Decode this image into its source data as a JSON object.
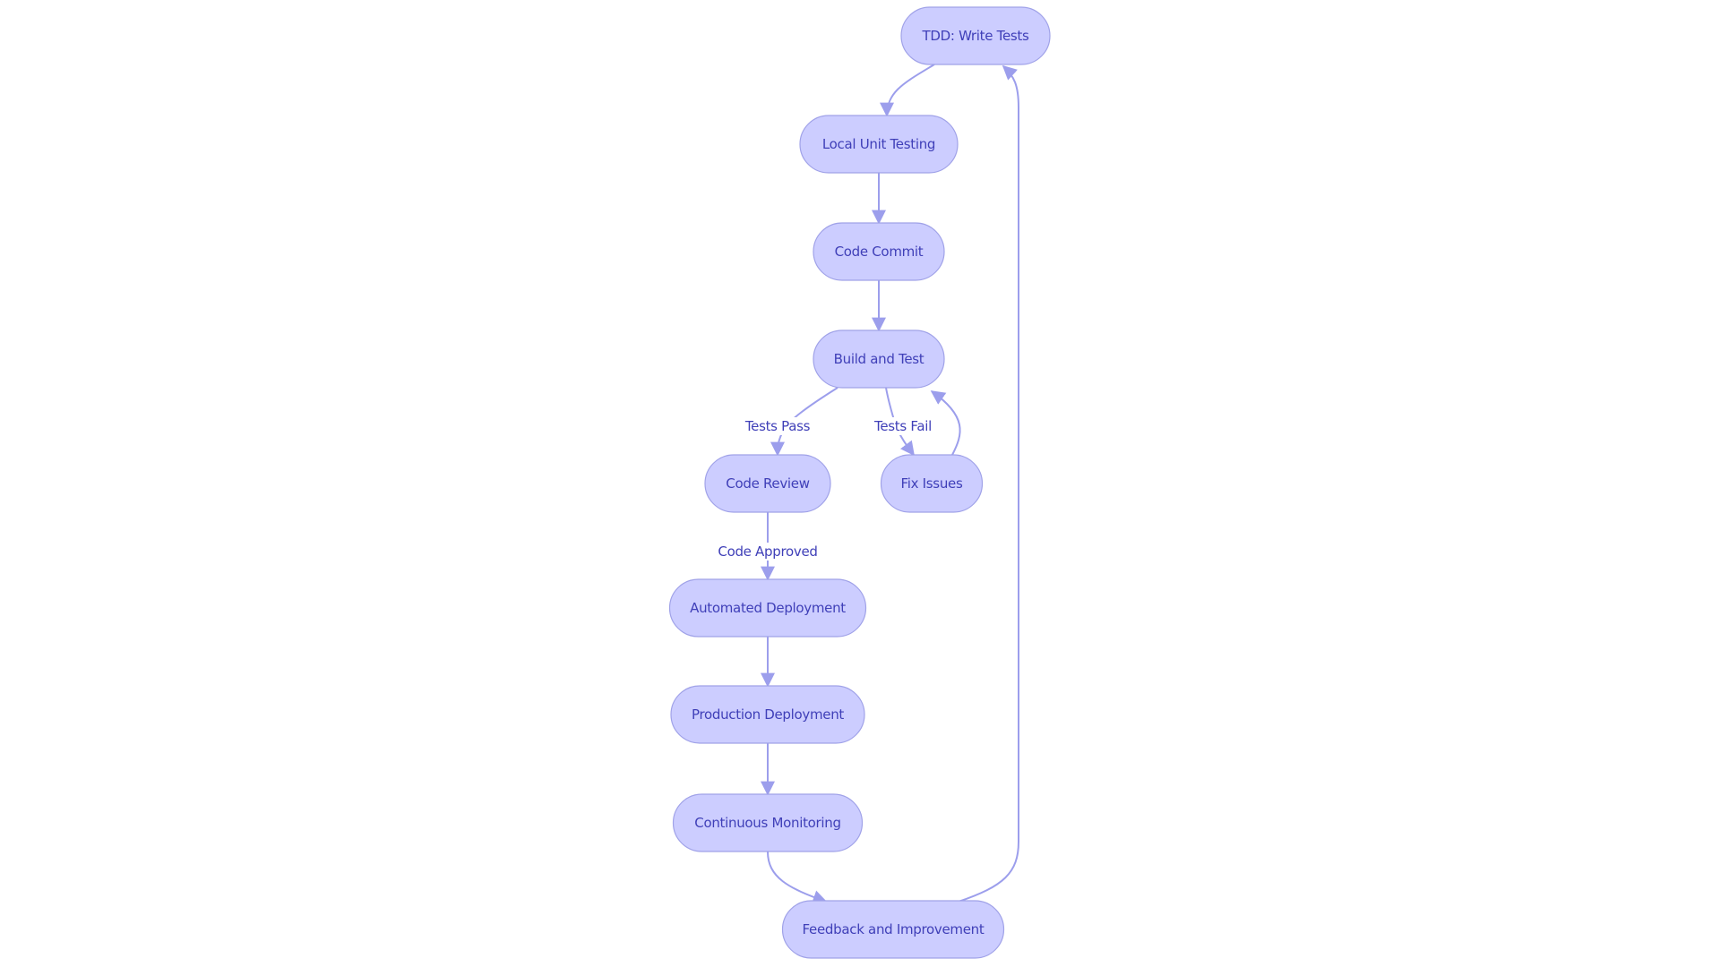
{
  "diagram": {
    "type": "flowchart",
    "direction": "top-down",
    "colors": {
      "node_fill": "#cccdff",
      "node_stroke": "#a0a2e8",
      "text": "#3f3fb8",
      "edge": "#9c9eec"
    },
    "nodes": [
      {
        "id": "tdd",
        "label": "TDD: Write Tests"
      },
      {
        "id": "local",
        "label": "Local Unit Testing"
      },
      {
        "id": "commit",
        "label": "Code Commit"
      },
      {
        "id": "build",
        "label": "Build and Test"
      },
      {
        "id": "review",
        "label": "Code Review"
      },
      {
        "id": "fix",
        "label": "Fix Issues"
      },
      {
        "id": "autodeploy",
        "label": "Automated Deployment"
      },
      {
        "id": "proddeploy",
        "label": "Production Deployment"
      },
      {
        "id": "monitor",
        "label": "Continuous Monitoring"
      },
      {
        "id": "feedback",
        "label": "Feedback and Improvement"
      }
    ],
    "edges": [
      {
        "from": "tdd",
        "to": "local",
        "label": ""
      },
      {
        "from": "local",
        "to": "commit",
        "label": ""
      },
      {
        "from": "commit",
        "to": "build",
        "label": ""
      },
      {
        "from": "build",
        "to": "review",
        "label": "Tests Pass"
      },
      {
        "from": "build",
        "to": "fix",
        "label": "Tests Fail"
      },
      {
        "from": "fix",
        "to": "build",
        "label": ""
      },
      {
        "from": "review",
        "to": "autodeploy",
        "label": "Code Approved"
      },
      {
        "from": "autodeploy",
        "to": "proddeploy",
        "label": ""
      },
      {
        "from": "proddeploy",
        "to": "monitor",
        "label": ""
      },
      {
        "from": "monitor",
        "to": "feedback",
        "label": ""
      },
      {
        "from": "feedback",
        "to": "tdd",
        "label": ""
      }
    ]
  }
}
